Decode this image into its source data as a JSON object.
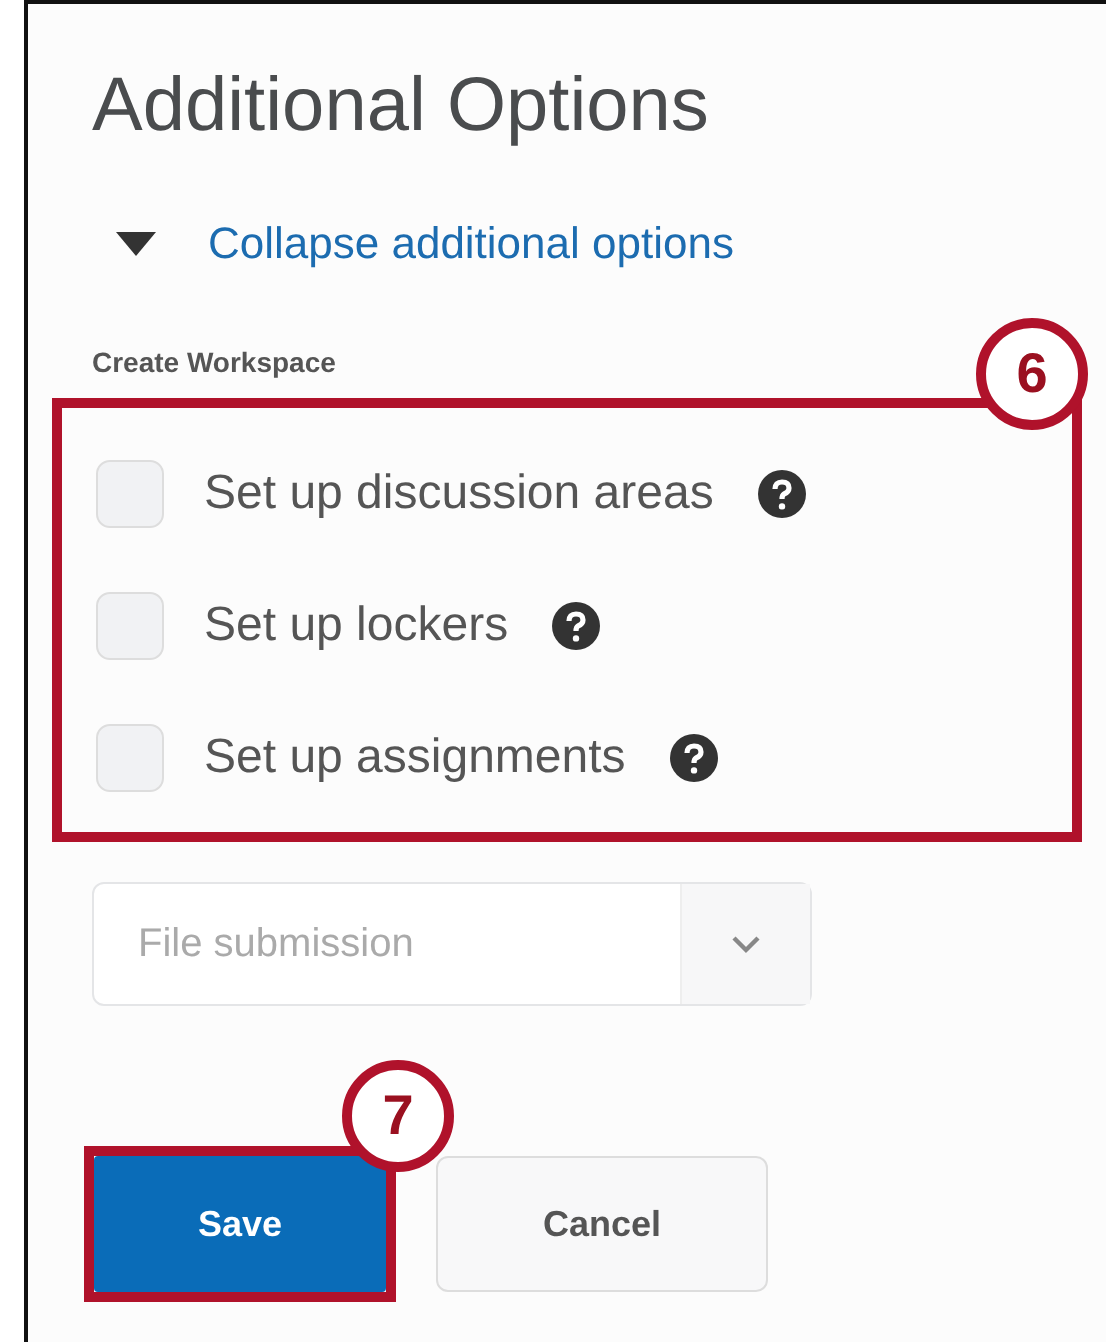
{
  "title": "Additional Options",
  "toggle": {
    "label": "Collapse additional options",
    "expanded": true
  },
  "section_label": "Create Workspace",
  "options": [
    {
      "label": "Set up discussion areas",
      "checked": false
    },
    {
      "label": "Set up lockers",
      "checked": false
    },
    {
      "label": "Set up assignments",
      "checked": false
    }
  ],
  "dropdown": {
    "value": "File submission",
    "disabled": true
  },
  "callouts": [
    {
      "number": "6"
    },
    {
      "number": "7"
    }
  ],
  "buttons": [
    {
      "label": "Save",
      "kind": "primary"
    },
    {
      "label": "Cancel",
      "kind": "secondary"
    }
  ]
}
